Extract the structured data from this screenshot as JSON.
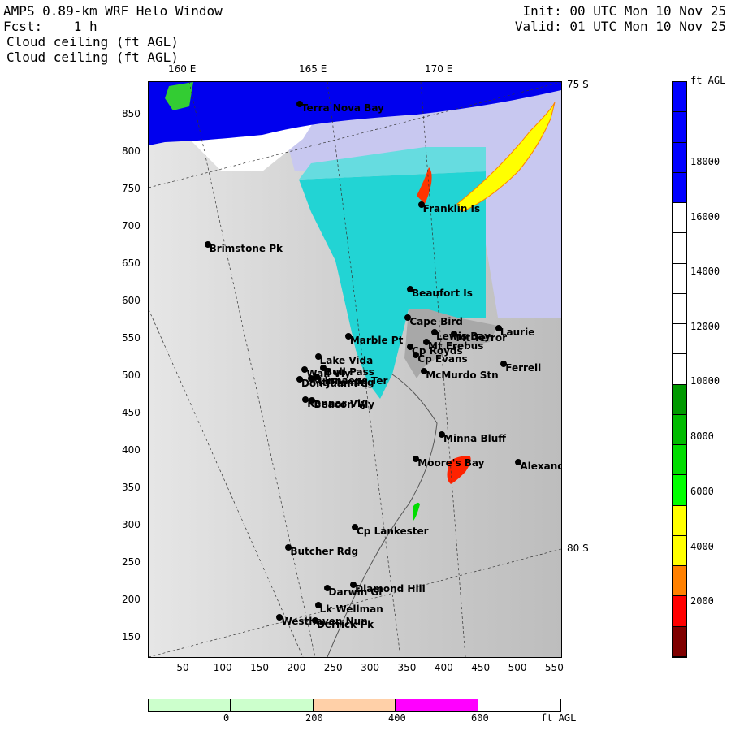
{
  "header": {
    "title": "AMPS 0.89-km WRF Helo Window",
    "fcst": "Fcst:    1 h",
    "field1": "Cloud ceiling (ft AGL)",
    "field2": "Cloud ceiling (ft AGL)",
    "init": "Init: 00 UTC Mon 10 Nov 25",
    "valid": "Valid: 01 UTC Mon 10 Nov 25"
  },
  "map": {
    "lon_labels": [
      "160 E",
      "165 E",
      "170 E"
    ],
    "lat_labels": [
      "75 S",
      "80 S"
    ],
    "x_ticks": [
      "50",
      "100",
      "150",
      "200",
      "250",
      "300",
      "350",
      "400",
      "450",
      "500",
      "550"
    ],
    "y_ticks": [
      "850",
      "800",
      "750",
      "700",
      "650",
      "600",
      "550",
      "500",
      "450",
      "400",
      "350",
      "300",
      "250",
      "200",
      "150"
    ],
    "places": [
      {
        "name": "Terra Nova Bay",
        "x": 205,
        "y": 866
      },
      {
        "name": "Franklin Is",
        "x": 370,
        "y": 731
      },
      {
        "name": "Brimstone Pk",
        "x": 80,
        "y": 677
      },
      {
        "name": "Beaufort Is",
        "x": 355,
        "y": 618
      },
      {
        "name": "Cape Bird",
        "x": 352,
        "y": 580
      },
      {
        "name": "Lewis Bay",
        "x": 388,
        "y": 560
      },
      {
        "name": "Mt Terror",
        "x": 415,
        "y": 558
      },
      {
        "name": "Laurie",
        "x": 475,
        "y": 565
      },
      {
        "name": "Marble Pt",
        "x": 271,
        "y": 555
      },
      {
        "name": "Mt Erebus",
        "x": 377,
        "y": 547
      },
      {
        "name": "Cp Royds",
        "x": 355,
        "y": 540
      },
      {
        "name": "Lake Vida",
        "x": 230,
        "y": 527
      },
      {
        "name": "Cp Evans",
        "x": 363,
        "y": 530
      },
      {
        "name": "Ferrell",
        "x": 482,
        "y": 518
      },
      {
        "name": "Wall Vly",
        "x": 212,
        "y": 510
      },
      {
        "name": "Bull Pass",
        "x": 237,
        "y": 512
      },
      {
        "name": "McMurdo Stn",
        "x": 374,
        "y": 508
      },
      {
        "name": "Don Juan Pd",
        "x": 205,
        "y": 497
      },
      {
        "name": "Mt Fleming",
        "x": 220,
        "y": 498
      },
      {
        "name": "Linnaeus Ter",
        "x": 228,
        "y": 500
      },
      {
        "name": "Kennar Vly",
        "x": 213,
        "y": 470
      },
      {
        "name": "Beacon Vly",
        "x": 222,
        "y": 469
      },
      {
        "name": "Minna Bluff",
        "x": 398,
        "y": 423
      },
      {
        "name": "Moore's Bay",
        "x": 363,
        "y": 390
      },
      {
        "name": "Alexander",
        "x": 502,
        "y": 386
      },
      {
        "name": "Cp Lankester",
        "x": 280,
        "y": 299
      },
      {
        "name": "Butcher Rdg",
        "x": 190,
        "y": 272
      },
      {
        "name": "Darwin Gl",
        "x": 242,
        "y": 217
      },
      {
        "name": "Diamond Hill",
        "x": 278,
        "y": 222
      },
      {
        "name": "Lk Wellman",
        "x": 230,
        "y": 195
      },
      {
        "name": "Westhaven Nun",
        "x": 178,
        "y": 178
      },
      {
        "name": "Derrick Pk",
        "x": 226,
        "y": 174
      }
    ]
  },
  "ceiling_colorbar": {
    "unit": "ft AGL",
    "labels": [
      "18000",
      "16000",
      "14000",
      "12000",
      "10000",
      "8000",
      "6000",
      "4000",
      "2000"
    ],
    "colors": [
      "#0000ff",
      "#0000ff",
      "#0000ff",
      "#0000ff",
      "#ffffff",
      "#ffffff",
      "#ffffff",
      "#ffffff",
      "#ffffff",
      "#ffffff",
      "#009900",
      "#00bb00",
      "#00dd00",
      "#00ff00",
      "#ffff00",
      "#ffff00",
      "#ff8000",
      "#ff0000",
      "#7f0000"
    ]
  },
  "terrain_colorbar": {
    "unit": "ft AGL",
    "labels": [
      "0",
      "200",
      "400",
      "600"
    ],
    "colors": [
      "#ccffcc",
      "#ccffcc",
      "#ffd0a8",
      "#ff00ff",
      "#ffffff"
    ]
  }
}
